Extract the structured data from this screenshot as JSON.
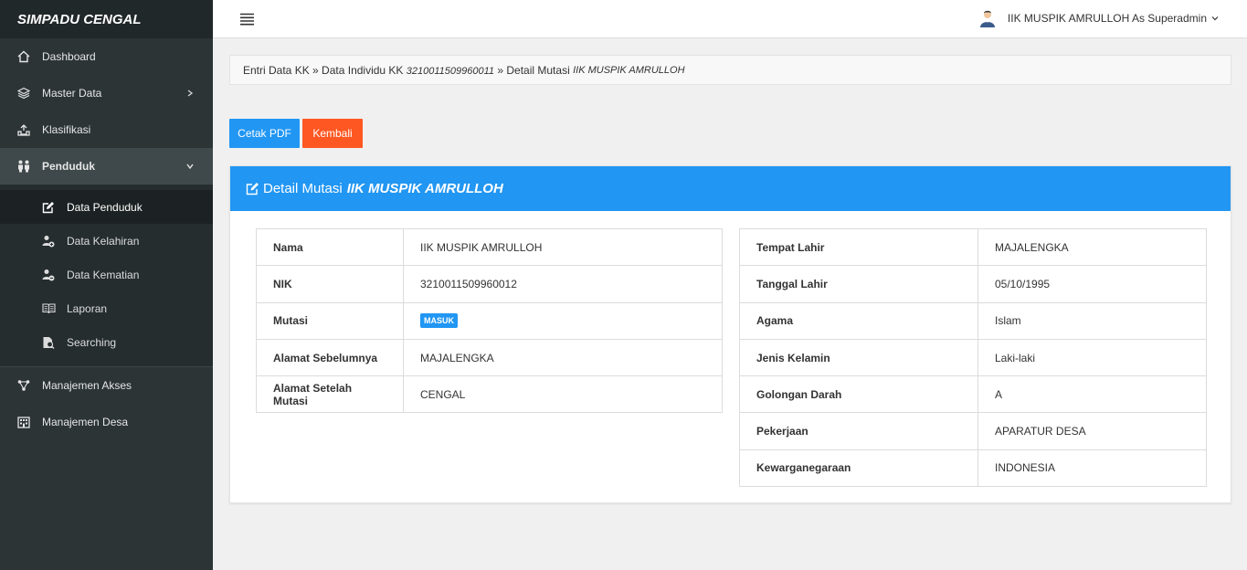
{
  "app": {
    "title": "SIMPADU CENGAL"
  },
  "sidebar": {
    "items": [
      {
        "label": "Dashboard",
        "icon": "home-icon"
      },
      {
        "label": "Master Data",
        "icon": "layers-icon"
      },
      {
        "label": "Klasifikasi",
        "icon": "upload-icon"
      },
      {
        "label": "Penduduk",
        "icon": "people-icon"
      },
      {
        "label": "Manajemen Akses",
        "icon": "access-icon"
      },
      {
        "label": "Manajemen Desa",
        "icon": "building-icon"
      }
    ],
    "sub_items": [
      {
        "label": "Data Penduduk",
        "icon": "edit-icon"
      },
      {
        "label": "Data Kelahiran",
        "icon": "user-add-icon"
      },
      {
        "label": "Data Kematian",
        "icon": "user-remove-icon"
      },
      {
        "label": "Laporan",
        "icon": "book-icon"
      },
      {
        "label": "Searching",
        "icon": "search-file-icon"
      }
    ]
  },
  "topbar": {
    "user_label": "IIK MUSPIK AMRULLOH As Superadmin"
  },
  "breadcrumb": {
    "part1": "Entri Data KK",
    "sep": " » ",
    "part2": "Data Individu KK",
    "kk_number": "3210011509960011",
    "part3": "Detail Mutasi",
    "name": "IIK MUSPIK AMRULLOH"
  },
  "buttons": {
    "pdf": "Cetak PDF",
    "back": "Kembali"
  },
  "panel": {
    "title": "Detail Mutasi",
    "name": "IIK MUSPIK AMRULLOH"
  },
  "left_table": [
    {
      "key": "Nama",
      "value": "IIK MUSPIK AMRULLOH"
    },
    {
      "key": "NIK",
      "value": "3210011509960012"
    },
    {
      "key": "Mutasi",
      "value": "MASUK"
    },
    {
      "key": "Alamat Sebelumnya",
      "value": "MAJALENGKA"
    },
    {
      "key": "Alamat Setelah Mutasi",
      "value": "CENGAL"
    }
  ],
  "right_table": [
    {
      "key": "Tempat Lahir",
      "value": "MAJALENGKA"
    },
    {
      "key": "Tanggal Lahir",
      "value": "05/10/1995"
    },
    {
      "key": "Agama",
      "value": "Islam"
    },
    {
      "key": "Jenis Kelamin",
      "value": "Laki-laki"
    },
    {
      "key": "Golongan Darah",
      "value": "A"
    },
    {
      "key": "Pekerjaan",
      "value": "APARATUR DESA"
    },
    {
      "key": "Kewarganegaraan",
      "value": "INDONESIA"
    }
  ],
  "colors": {
    "accent": "#2196f3",
    "danger": "#ff5722",
    "sidebar": "#2c3436"
  }
}
